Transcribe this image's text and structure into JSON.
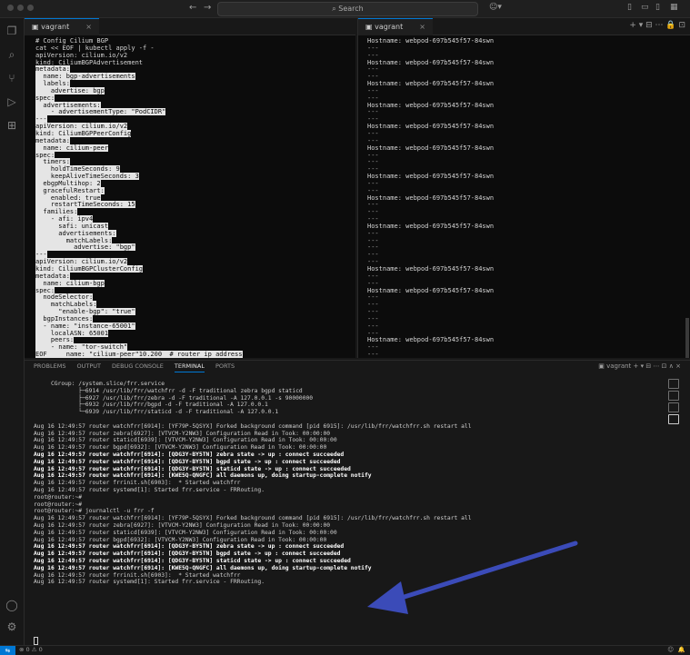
{
  "titlebar": {
    "search_label": "Search",
    "back": "←",
    "forward": "→"
  },
  "editor_left": {
    "tab_label": "vagrant",
    "lines": [
      {
        "t": "# Config Cilium BGP",
        "h": false
      },
      {
        "t": "cat << EOF | kubectl apply -f -",
        "h": false
      },
      {
        "t": "apiVersion: cilium.io/v2",
        "h": false
      },
      {
        "t": "kind: CiliumBGPAdvertisement",
        "h": false
      },
      {
        "t": "metadata:",
        "h": true
      },
      {
        "t": "  name: bgp-advertisements",
        "h": true
      },
      {
        "t": "  labels:",
        "h": true
      },
      {
        "t": "    advertise: bgp",
        "h": true
      },
      {
        "t": "spec:",
        "h": true
      },
      {
        "t": "  advertisements:",
        "h": true
      },
      {
        "t": "    - advertisementType: \"PodCIDR\"",
        "h": true
      },
      {
        "t": "---",
        "h": true
      },
      {
        "t": "apiVersion: cilium.io/v2",
        "h": true
      },
      {
        "t": "kind: CiliumBGPPeerConfig",
        "h": true
      },
      {
        "t": "metadata:",
        "h": true
      },
      {
        "t": "  name: cilium-peer",
        "h": true
      },
      {
        "t": "spec:",
        "h": true
      },
      {
        "t": "  timers:",
        "h": true
      },
      {
        "t": "    holdTimeSeconds: 9",
        "h": true
      },
      {
        "t": "    keepAliveTimeSeconds: 3",
        "h": true
      },
      {
        "t": "  ebgpMultihop: 2",
        "h": true
      },
      {
        "t": "  gracefulRestart:",
        "h": true
      },
      {
        "t": "    enabled: true",
        "h": true
      },
      {
        "t": "    restartTimeSeconds: 15",
        "h": true
      },
      {
        "t": "  families:",
        "h": true
      },
      {
        "t": "    - afi: ipv4",
        "h": true
      },
      {
        "t": "      safi: unicast",
        "h": true
      },
      {
        "t": "      advertisements:",
        "h": true
      },
      {
        "t": "        matchLabels:",
        "h": true
      },
      {
        "t": "          advertise: \"bgp\"",
        "h": true
      },
      {
        "t": "---",
        "h": true
      },
      {
        "t": "apiVersion: cilium.io/v2",
        "h": true
      },
      {
        "t": "kind: CiliumBGPClusterConfig",
        "h": true
      },
      {
        "t": "metadata:",
        "h": true
      },
      {
        "t": "  name: cilium-bgp",
        "h": true
      },
      {
        "t": "spec:",
        "h": true
      },
      {
        "t": "  nodeSelector:",
        "h": true
      },
      {
        "t": "    matchLabels:",
        "h": true
      },
      {
        "t": "      \"enable-bgp\": \"true\"",
        "h": true
      },
      {
        "t": "  bgpInstances:",
        "h": true
      },
      {
        "t": "  - name: \"instance-65001\"",
        "h": true
      },
      {
        "t": "    localASN: 65001",
        "h": true
      },
      {
        "t": "    peers:",
        "h": true
      },
      {
        "t": "    - name: \"tor-switch\"",
        "h": true
      },
      {
        "t": "EOF     name: \"cilium-peer\"10.200  # router ip address",
        "h": true
      }
    ]
  },
  "editor_right": {
    "tab_label": "vagrant",
    "hostname": "Hostname: webpod-697b545f57-84swn",
    "sep": "---",
    "pattern": [
      "h",
      "s",
      "s",
      "h",
      "s",
      "s",
      "h",
      "s",
      "s",
      "h",
      "s",
      "s",
      "h",
      "s",
      "s",
      "h",
      "s",
      "s",
      "s",
      "h",
      "s",
      "s",
      "h",
      "s",
      "s",
      "s",
      "h",
      "s",
      "s",
      "s",
      "s",
      "s",
      "h",
      "s",
      "s",
      "h",
      "s",
      "s",
      "s",
      "s",
      "s",
      "s",
      "h",
      "s",
      "s",
      "s"
    ]
  },
  "panel": {
    "tabs": [
      "PROBLEMS",
      "OUTPUT",
      "DEBUG CONSOLE",
      "TERMINAL",
      "PORTS"
    ],
    "active_tab": "TERMINAL",
    "terminal_name": "vagrant",
    "lines": [
      {
        "t": "     CGroup: /system.slice/frr.service",
        "b": false
      },
      {
        "t": "             ├─6914 /usr/lib/frr/watchfrr -d -F traditional zebra bgpd staticd",
        "b": false
      },
      {
        "t": "             ├─6927 /usr/lib/frr/zebra -d -F traditional -A 127.0.0.1 -s 90000000",
        "b": false
      },
      {
        "t": "             ├─6932 /usr/lib/frr/bgpd -d -F traditional -A 127.0.0.1",
        "b": false
      },
      {
        "t": "             └─6939 /usr/lib/frr/staticd -d -F traditional -A 127.0.0.1",
        "b": false
      },
      {
        "t": "",
        "b": false
      },
      {
        "t": "Aug 16 12:49:57 router watchfrr[6914]: [YF79P-5QSYX] Forked background command [pid 6915]: /usr/lib/frr/watchfrr.sh restart all",
        "b": false
      },
      {
        "t": "Aug 16 12:49:57 router zebra[6927]: [VTVCM-Y2NW3] Configuration Read in Took: 00:00:00",
        "b": false
      },
      {
        "t": "Aug 16 12:49:57 router staticd[6939]: [VTVCM-Y2NW3] Configuration Read in Took: 00:00:00",
        "b": false
      },
      {
        "t": "Aug 16 12:49:57 router bgpd[6932]: [VTVCM-Y2NW3] Configuration Read in Took: 00:00:00",
        "b": false
      },
      {
        "t": "Aug 16 12:49:57 router watchfrr[6914]: [QDG3Y-BY5TN] zebra state -> up : connect succeeded",
        "b": true
      },
      {
        "t": "Aug 16 12:49:57 router watchfrr[6914]: [QDG3Y-BY5TN] bgpd state -> up : connect succeeded",
        "b": true
      },
      {
        "t": "Aug 16 12:49:57 router watchfrr[6914]: [QDG3Y-BY5TN] staticd state -> up : connect succeeded",
        "b": true
      },
      {
        "t": "Aug 16 12:49:57 router watchfrr[6914]: [KWE5Q-QNGFC] all daemons up, doing startup-complete notify",
        "b": true
      },
      {
        "t": "Aug 16 12:49:57 router frrinit.sh[6903]:  * Started watchfrr",
        "b": false
      },
      {
        "t": "Aug 16 12:49:57 router systemd[1]: Started frr.service - FRRouting.",
        "b": false
      },
      {
        "t": "root@router:~#",
        "b": false
      },
      {
        "t": "root@router:~#",
        "b": false
      },
      {
        "t": "root@router:~# journalctl -u frr -f",
        "b": false
      },
      {
        "t": "Aug 16 12:49:57 router watchfrr[6914]: [YF79P-5QSYX] Forked background command [pid 6915]: /usr/lib/frr/watchfrr.sh restart all",
        "b": false
      },
      {
        "t": "Aug 16 12:49:57 router zebra[6927]: [VTVCM-Y2NW3] Configuration Read in Took: 00:00:00",
        "b": false
      },
      {
        "t": "Aug 16 12:49:57 router staticd[6939]: [VTVCM-Y2NW3] Configuration Read in Took: 00:00:00",
        "b": false
      },
      {
        "t": "Aug 16 12:49:57 router bgpd[6932]: [VTVCM-Y2NW3] Configuration Read in Took: 00:00:00",
        "b": false
      },
      {
        "t": "Aug 16 12:49:57 router watchfrr[6914]: [QDG3Y-BY5TN] zebra state -> up : connect succeeded",
        "b": true
      },
      {
        "t": "Aug 16 12:49:57 router watchfrr[6914]: [QDG3Y-BY5TN] bgpd state -> up : connect succeeded",
        "b": true
      },
      {
        "t": "Aug 16 12:49:57 router watchfrr[6914]: [QDG3Y-BY5TN] staticd state -> up : connect succeeded",
        "b": true
      },
      {
        "t": "Aug 16 12:49:57 router watchfrr[6914]: [KWE5Q-QNGFC] all daemons up, doing startup-complete notify",
        "b": true
      },
      {
        "t": "Aug 16 12:49:57 router frrinit.sh[6903]:  * Started watchfrr",
        "b": false
      },
      {
        "t": "Aug 16 12:49:57 router systemd[1]: Started frr.service - FRRouting.",
        "b": false
      }
    ]
  },
  "status": {
    "problems": "⊗ 0 ⚠ 0"
  },
  "colors": {
    "accent": "#0078d4",
    "arrow": "#3b4bb8"
  }
}
